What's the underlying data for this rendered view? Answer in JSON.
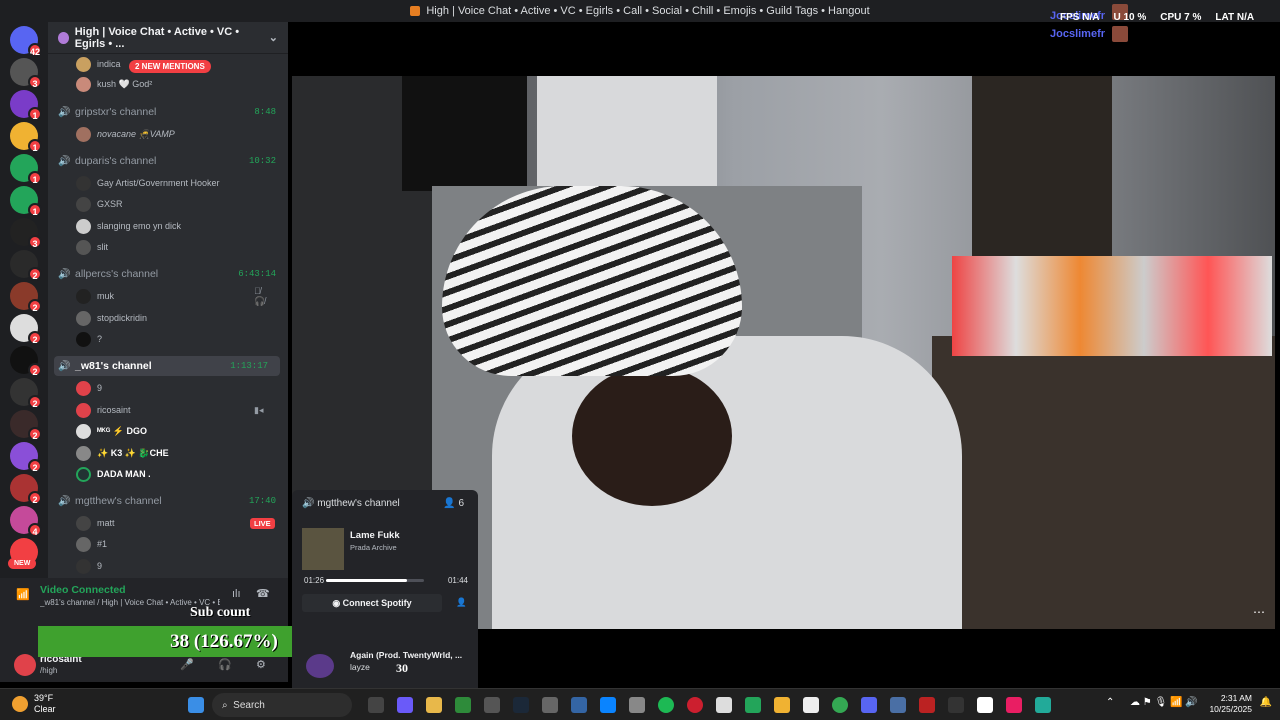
{
  "window": {
    "title": "High | Voice Chat • Active • VC • Egirls • Call • Social • Chill • Emojis • Guild Tags • Hangout"
  },
  "overlay": {
    "name1": "Jocslimefr",
    "name2": "Jocslimefr",
    "fps": "FPS N/A",
    "gpu": "U 10 %",
    "cpu": "CPU 7 %",
    "lat": "LAT N/A"
  },
  "guilds": {
    "badges": [
      "42",
      "3",
      "1",
      "1",
      "1",
      "1",
      "3",
      "2",
      "2",
      "2",
      "2",
      "2",
      "2",
      "2",
      "2",
      "2",
      "4"
    ],
    "new_label": "NEW"
  },
  "server": {
    "name": "High | Voice Chat • Active • VC • Egirls • ..."
  },
  "mentions": "2 NEW MENTIONS",
  "channels": [
    {
      "name": "gripstxr's channel",
      "time": "8:48"
    },
    {
      "name": "duparis's channel",
      "time": "10:32"
    },
    {
      "name": "allpercs's channel",
      "time": "6:43:14"
    },
    {
      "name": "_w81's channel",
      "time": "1:13:17"
    },
    {
      "name": "mgtthew's channel",
      "time": "17:40"
    }
  ],
  "users": {
    "indica": "indica",
    "kush": "kush 🤍 God²",
    "novacane": "novacane 🥷VAMP",
    "gay_artist": "Gay Artist/Government Hooker",
    "gxsr": "GXSR",
    "slanging": "slanging emo yn dick",
    "slit": "slit",
    "muk": "muk",
    "stopdick": "stopdickridin",
    "q": "?",
    "nine1": "9",
    "ricosaint": "ricosaint",
    "dgo": "ᴹᴷᴳ ⚡ DGO",
    "k3": "✨ K3 ✨ 🐉CHE",
    "dadaman": "DADA MAN .",
    "matt": "matt",
    "one": "#1",
    "nine2": "9"
  },
  "live_label": "LIVE",
  "voice": {
    "status": "Video Connected",
    "channel": "_w81's channel / High | Voice Chat • Active • VC • E..."
  },
  "stream_overlay": {
    "label": "Sub count",
    "value": "38 (126.67%)"
  },
  "user_panel": {
    "name": "ricosaint",
    "sub": "/high"
  },
  "popup": {
    "channel": "mgtthew's channel",
    "count": "6",
    "song": "Lame Fukk",
    "album": "Prada Archive",
    "elapsed": "01:26",
    "total": "01:44",
    "progress": 0.83,
    "button": "Connect Spotify",
    "line2": "Again (Prod. TwentyWrld, ...",
    "artist": "layze",
    "num": "30"
  },
  "taskbar": {
    "temp": "39°F",
    "cond": "Clear",
    "search": "Search",
    "time": "2:31 AM",
    "date": "10/25/2025"
  },
  "colors": {
    "accent": "#23a55a",
    "danger": "#f23f43",
    "blurple": "#5865f2"
  }
}
